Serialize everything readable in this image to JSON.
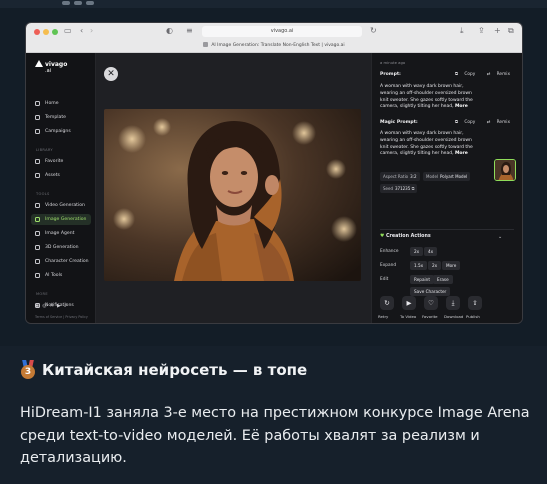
{
  "browser": {
    "url": "vivago.ai",
    "tab_title": "AI Image Generation: Translate Non-English Text | vivago.ai"
  },
  "sidebar": {
    "logo_name": "vivago",
    "logo_suffix": ".ai",
    "items": [
      {
        "label": "Home",
        "icon": "home-icon"
      },
      {
        "label": "Template",
        "icon": "template-icon"
      },
      {
        "label": "Campaigns",
        "icon": "campaign-icon"
      }
    ],
    "library_heading": "LIBRARY",
    "library_items": [
      {
        "label": "Favorite",
        "icon": "heart-icon"
      },
      {
        "label": "Assets",
        "icon": "folder-icon"
      }
    ],
    "tools_heading": "TOOLS",
    "tool_items": [
      {
        "label": "Video Generation",
        "icon": "video-icon"
      },
      {
        "label": "Image Generation",
        "icon": "image-icon",
        "active": true
      },
      {
        "label": "Image Agent",
        "icon": "agent-icon"
      },
      {
        "label": "3D Generation",
        "icon": "cube-icon"
      },
      {
        "label": "Character Creation",
        "icon": "character-icon"
      },
      {
        "label": "AI Tools",
        "icon": "tools-icon"
      }
    ],
    "more_heading": "MORE",
    "more_items": [
      {
        "label": "Notifications",
        "icon": "bell-icon"
      }
    ],
    "footer": "Terms of Service  |  Privacy Policy"
  },
  "panel": {
    "time": "a minute ago",
    "prompt_label": "Prompt:",
    "copy_label": "Copy",
    "remix_label": "Remix",
    "prompt_text": "A woman with wavy dark brown hair, wearing an off-shoulder oversized brown knit sweater. She gazes softly toward the camera, slightly tilting her head,",
    "more_label": "More",
    "magic_label": "Magic Prompt:",
    "magic_text": "A woman with wavy dark brown hair, wearing an off-shoulder oversized brown knit sweater. She gazes softly toward the camera, slightly tilting her head,",
    "aspect_label": "Aspect Ratio",
    "aspect_value": "3:2",
    "model_label": "Model",
    "model_value": "Polyart Model",
    "seed_label": "Seed",
    "seed_value": "371235",
    "creation_title": "Creation Actions",
    "enhance_label": "Enhance",
    "enhance_opts": [
      "2x",
      "4x"
    ],
    "expand_label": "Expand",
    "expand_opts": [
      "1.5x",
      "2x",
      "More"
    ],
    "edit_label": "Edit",
    "edit_opts": [
      "Repaint",
      "Erase"
    ],
    "save_character": "Save Character",
    "actions": [
      {
        "label": "Retry",
        "icon": "retry-icon",
        "glyph": "↻"
      },
      {
        "label": "To Video",
        "icon": "video-icon",
        "glyph": "▶"
      },
      {
        "label": "Favorite",
        "icon": "heart-icon",
        "glyph": "♡"
      },
      {
        "label": "Download",
        "icon": "download-icon",
        "glyph": "⤓"
      },
      {
        "label": "Publish",
        "icon": "publish-icon",
        "glyph": "⇪"
      }
    ]
  },
  "post": {
    "title": "Китайская нейросеть — в топе",
    "medal_number": "3",
    "body": "HiDream-I1 заняла 3-е место на престижном конкурсе Image Arena среди text-to-video моделей. Её работы хвалят за реализм и детализацию."
  },
  "colors": {
    "accent": "#8fdc5a",
    "page_bg": "#16202b"
  }
}
